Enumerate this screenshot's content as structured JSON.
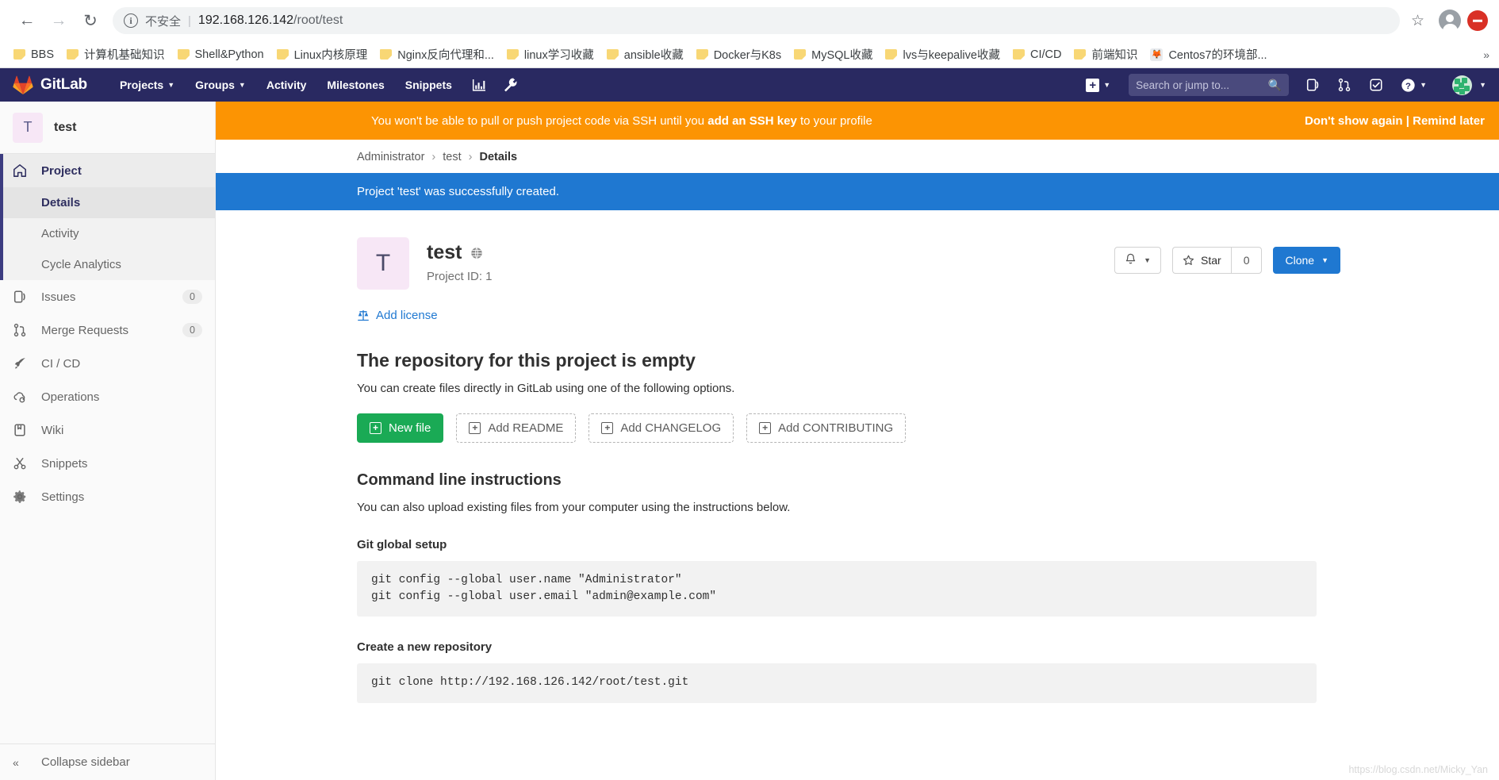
{
  "browser": {
    "nav": {
      "back_icon": "arrow-left",
      "forward_icon": "arrow-right",
      "reload_icon": "reload"
    },
    "omnibox": {
      "security_label": "不安全",
      "separator": "|",
      "url_host": "192.168.126.142",
      "url_path": "/root/test"
    },
    "bookmarks": [
      {
        "label": "BBS",
        "icon": "folder-icon"
      },
      {
        "label": "计算机基础知识",
        "icon": "folder-icon"
      },
      {
        "label": "Shell&Python",
        "icon": "folder-icon"
      },
      {
        "label": "Linux内核原理",
        "icon": "folder-icon"
      },
      {
        "label": "Nginx反向代理和...",
        "icon": "folder-icon"
      },
      {
        "label": "linux学习收藏",
        "icon": "folder-icon"
      },
      {
        "label": "ansible收藏",
        "icon": "folder-icon"
      },
      {
        "label": "Docker与K8s",
        "icon": "folder-icon"
      },
      {
        "label": "MySQL收藏",
        "icon": "folder-icon"
      },
      {
        "label": "lvs与keepalive收藏",
        "icon": "folder-icon"
      },
      {
        "label": "CI/CD",
        "icon": "folder-icon"
      },
      {
        "label": "前端知识",
        "icon": "folder-icon"
      },
      {
        "label": "Centos7的环境部...",
        "icon": "site-favicon"
      }
    ],
    "bookmark_overflow": "»"
  },
  "gitlab_nav": {
    "brand": "GitLab",
    "links": [
      {
        "label": "Projects",
        "has_caret": true
      },
      {
        "label": "Groups",
        "has_caret": true
      },
      {
        "label": "Activity",
        "has_caret": false
      },
      {
        "label": "Milestones",
        "has_caret": false
      },
      {
        "label": "Snippets",
        "has_caret": false
      }
    ],
    "icon_links": [
      "chart-icon",
      "wrench-icon"
    ],
    "new_button": "+",
    "search_placeholder": "Search or jump to...",
    "right_icons": [
      "issues-icon",
      "merge-requests-icon",
      "todos-icon",
      "help-icon",
      "avatar"
    ]
  },
  "banner": {
    "text_before": "You won't be able to pull or push project code via SSH until you ",
    "link": "add an SSH key",
    "text_after": " to your profile",
    "dont_show": "Don't show again",
    "divider": "|",
    "remind": "Remind later"
  },
  "sidebar": {
    "project_initial": "T",
    "project_name": "test",
    "items": [
      {
        "label": "Project",
        "icon": "home-icon",
        "active": true
      },
      {
        "label": "Issues",
        "icon": "issues-icon",
        "badge": "0"
      },
      {
        "label": "Merge Requests",
        "icon": "merge-requests-icon",
        "badge": "0"
      },
      {
        "label": "CI / CD",
        "icon": "rocket-icon"
      },
      {
        "label": "Operations",
        "icon": "cloud-gear-icon"
      },
      {
        "label": "Wiki",
        "icon": "book-icon"
      },
      {
        "label": "Snippets",
        "icon": "scissors-icon"
      },
      {
        "label": "Settings",
        "icon": "gear-icon"
      }
    ],
    "sub_items": [
      {
        "label": "Details",
        "selected": true
      },
      {
        "label": "Activity",
        "selected": false
      },
      {
        "label": "Cycle Analytics",
        "selected": false
      }
    ],
    "collapse_label": "Collapse sidebar",
    "collapse_icon": "chevron-double-left-icon"
  },
  "breadcrumb": {
    "items": [
      "Administrator",
      "test",
      "Details"
    ],
    "separator": "›"
  },
  "flash": {
    "message": "Project 'test' was successfully created."
  },
  "project": {
    "initial": "T",
    "name": "test",
    "visibility_icon": "globe-icon",
    "id_label": "Project ID: 1",
    "notification_icon": "bell-icon",
    "star_label": "Star",
    "star_icon": "star-icon",
    "star_count": "0",
    "clone_label": "Clone",
    "add_license_label": "Add license",
    "add_license_icon": "scale-icon"
  },
  "empty_repo": {
    "title": "The repository for this project is empty",
    "subtitle": "You can create files directly in GitLab using one of the following options.",
    "buttons": [
      {
        "label": "New file",
        "style": "primary"
      },
      {
        "label": "Add README",
        "style": "dashed"
      },
      {
        "label": "Add CHANGELOG",
        "style": "dashed"
      },
      {
        "label": "Add CONTRIBUTING",
        "style": "dashed"
      }
    ]
  },
  "command_line": {
    "title": "Command line instructions",
    "subtitle": "You can also upload existing files from your computer using the instructions below.",
    "sections": [
      {
        "heading": "Git global setup",
        "code": "git config --global user.name \"Administrator\"\ngit config --global user.email \"admin@example.com\""
      },
      {
        "heading": "Create a new repository",
        "code": "git clone http://192.168.126.142/root/test.git"
      }
    ]
  },
  "watermark": "https://blog.csdn.net/Micky_Yan"
}
